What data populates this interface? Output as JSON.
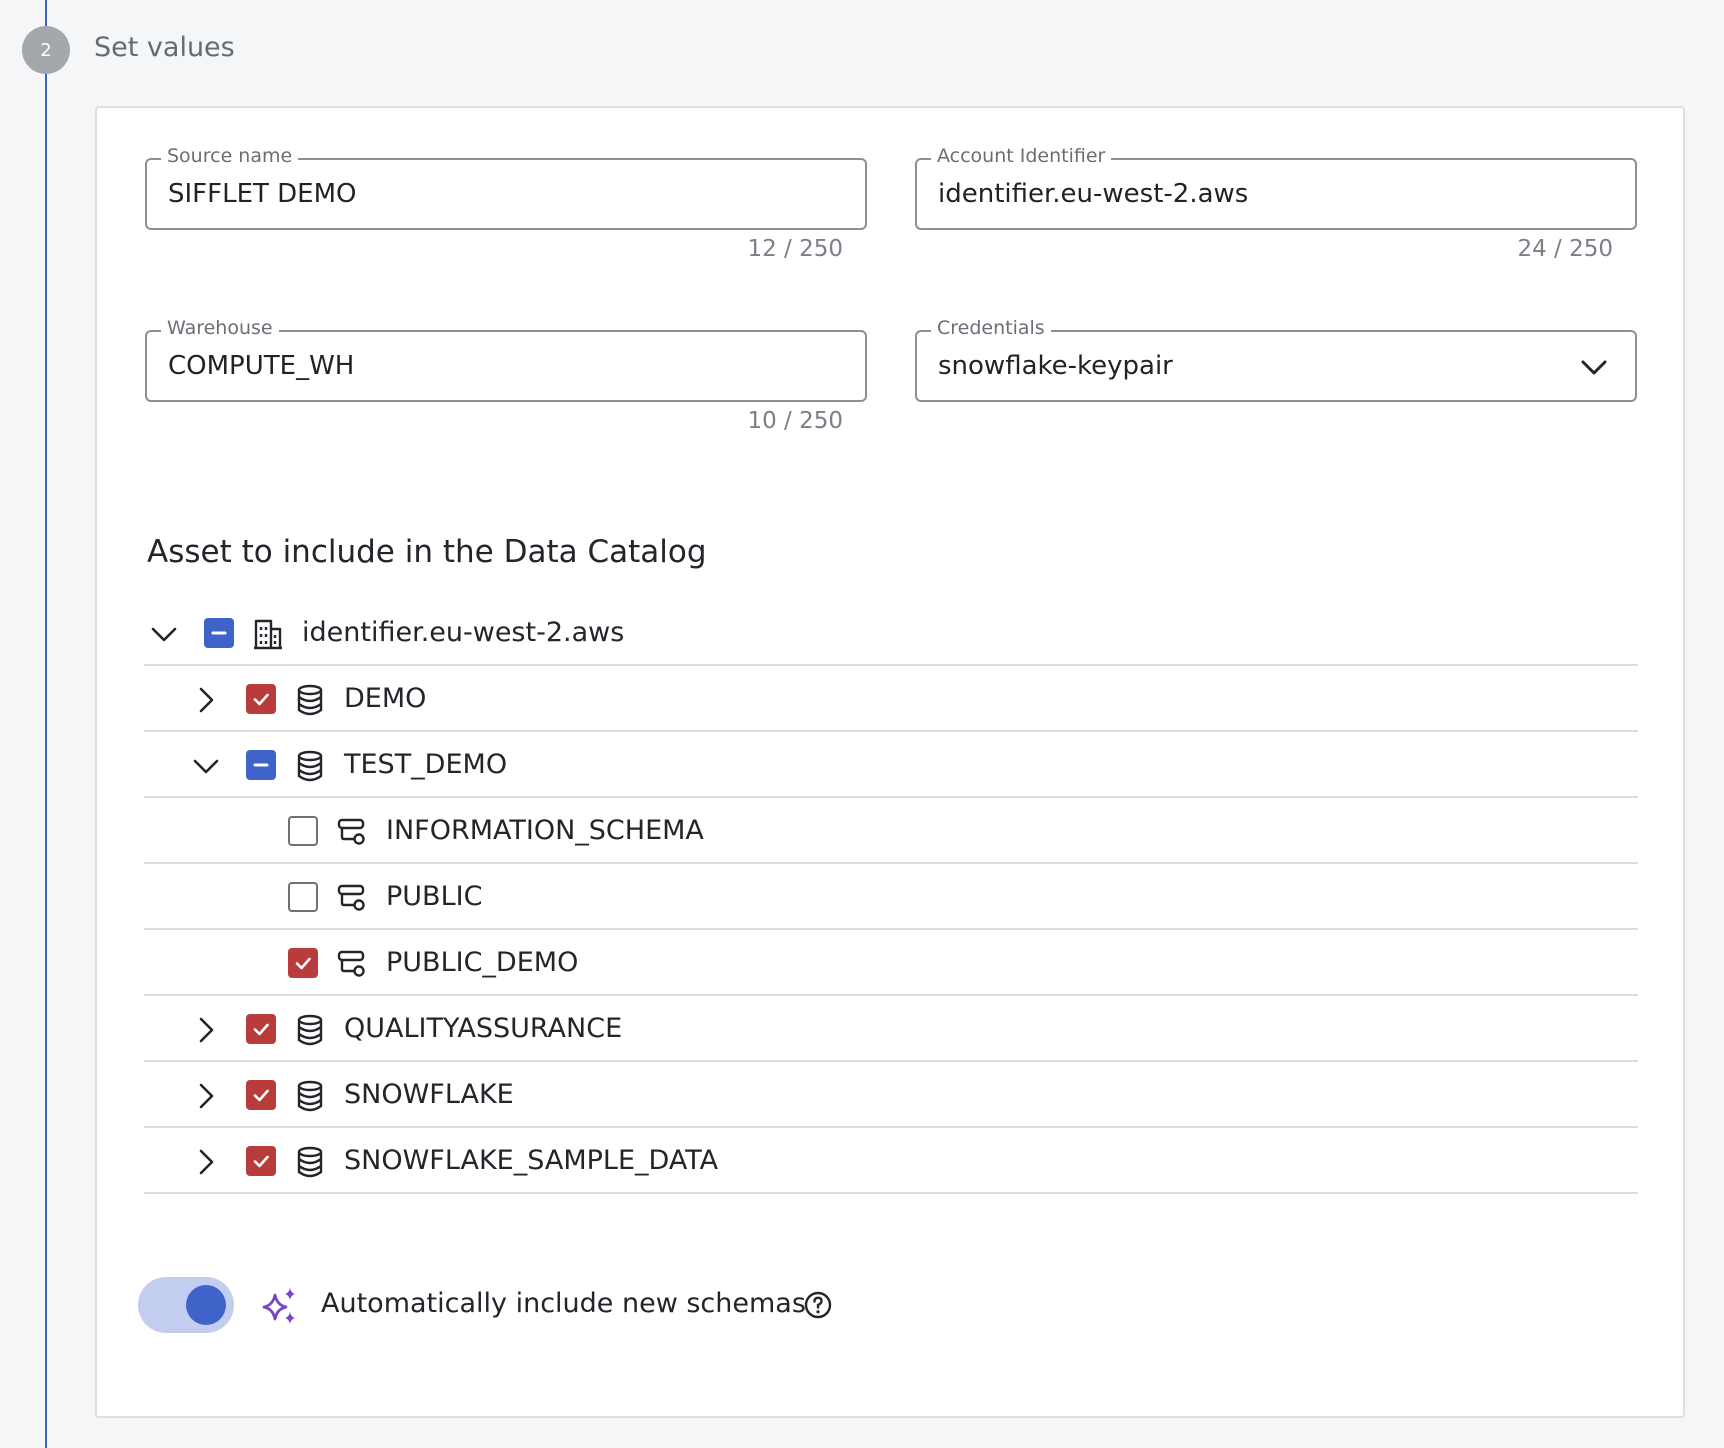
{
  "step": {
    "number": "2",
    "title": "Set values"
  },
  "fields": {
    "source_name": {
      "label": "Source name",
      "value": "SIFFLET DEMO",
      "counter": "12 / 250"
    },
    "account_identifier": {
      "label": "Account Identifier",
      "value": "identifier.eu-west-2.aws",
      "counter": "24 / 250"
    },
    "warehouse": {
      "label": "Warehouse",
      "value": "COMPUTE_WH",
      "counter": "10 / 250"
    },
    "credentials": {
      "label": "Credentials",
      "value": "snowflake-keypair"
    }
  },
  "catalog": {
    "title": "Asset to include in the Data Catalog",
    "tree": [
      {
        "label": "identifier.eu-west-2.aws",
        "level": 0,
        "expanded": true,
        "state": "partial",
        "icon": "building-icon"
      },
      {
        "label": "DEMO",
        "level": 1,
        "expanded": false,
        "state": "checked",
        "icon": "database-icon"
      },
      {
        "label": "TEST_DEMO",
        "level": 1,
        "expanded": true,
        "state": "partial",
        "icon": "database-icon"
      },
      {
        "label": "INFORMATION_SCHEMA",
        "level": 2,
        "expanded": null,
        "state": "unchecked",
        "icon": "schema-icon"
      },
      {
        "label": "PUBLIC",
        "level": 2,
        "expanded": null,
        "state": "unchecked",
        "icon": "schema-icon"
      },
      {
        "label": "PUBLIC_DEMO",
        "level": 2,
        "expanded": null,
        "state": "checked",
        "icon": "schema-icon"
      },
      {
        "label": "QUALITYASSURANCE",
        "level": 1,
        "expanded": false,
        "state": "checked",
        "icon": "database-icon"
      },
      {
        "label": "SNOWFLAKE",
        "level": 1,
        "expanded": false,
        "state": "checked",
        "icon": "database-icon"
      },
      {
        "label": "SNOWFLAKE_SAMPLE_DATA",
        "level": 1,
        "expanded": false,
        "state": "checked",
        "icon": "database-icon"
      }
    ]
  },
  "auto_include": {
    "label": "Automatically include new schemas",
    "enabled": true
  },
  "colors": {
    "accent": "#3f63c9",
    "checked": "#b83c3c",
    "sparkle": "#7b45c9"
  }
}
